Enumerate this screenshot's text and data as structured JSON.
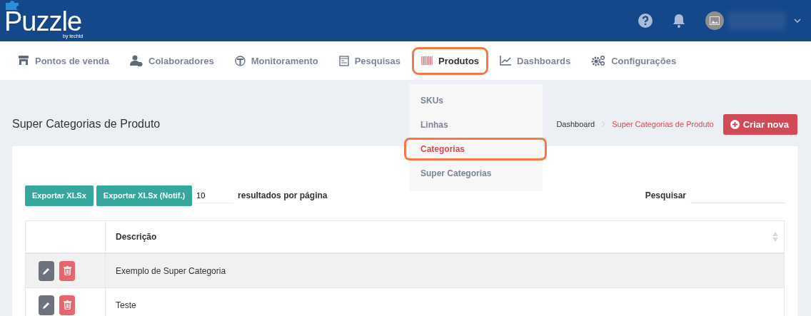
{
  "header": {
    "logo": "Puzzle",
    "logo_sub": "by techtd"
  },
  "nav": [
    {
      "label": "Pontos de venda",
      "kind": "store",
      "selected": false,
      "highlighted": false
    },
    {
      "label": "Colaboradores",
      "kind": "users",
      "selected": false,
      "highlighted": false
    },
    {
      "label": "Monitoramento",
      "kind": "pin",
      "selected": false,
      "highlighted": false
    },
    {
      "label": "Pesquisas",
      "kind": "form",
      "selected": false,
      "highlighted": false
    },
    {
      "label": "Produtos",
      "kind": "barcode",
      "selected": true,
      "highlighted": true
    },
    {
      "label": "Dashboards",
      "kind": "chart",
      "selected": false,
      "highlighted": false
    },
    {
      "label": "Configurações",
      "kind": "gears",
      "selected": false,
      "highlighted": false
    }
  ],
  "submenu": [
    {
      "label": "SKUs",
      "selected": false,
      "highlighted": false
    },
    {
      "label": "Linhas",
      "selected": false,
      "highlighted": false
    },
    {
      "label": "Categorias",
      "selected": true,
      "highlighted": true
    },
    {
      "label": "Super Categorias",
      "selected": false,
      "highlighted": false
    }
  ],
  "page": {
    "title": "Super Categorias de Produto",
    "breadcrumb": [
      {
        "label": "Dashboard",
        "selected": false
      },
      {
        "label": "Super Categorias de Produto",
        "selected": true
      }
    ],
    "create_button": "Criar nova"
  },
  "toolbar": {
    "buttons": [
      "Exportar XLSx",
      "Exportar XLSx (Notif.)"
    ],
    "page_size": "10",
    "page_size_label": "resultados por página",
    "search_label": "Pesquisar"
  },
  "table": {
    "columns": [
      "Descrição"
    ],
    "rows": [
      {
        "description": "Exemplo de Super Categoria"
      },
      {
        "description": "Teste"
      }
    ]
  }
}
